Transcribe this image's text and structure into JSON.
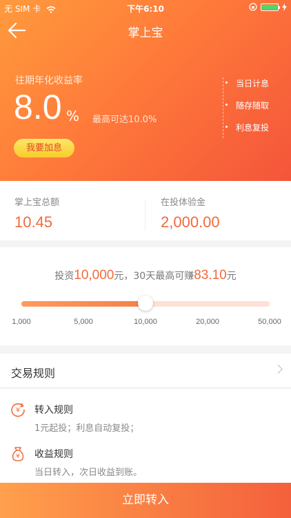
{
  "status_bar": {
    "carrier": "无 SIM 卡",
    "time": "下午6:10"
  },
  "nav": {
    "title": "掌上宝"
  },
  "hero": {
    "rate_label": "往期年化收益率",
    "rate_value": "8.0",
    "rate_unit": "%",
    "rate_max": "最高可达10.0%",
    "add_button": "我要加息",
    "features": [
      "当日计息",
      "随存随取",
      "利息复投"
    ]
  },
  "amounts": {
    "total_label": "掌上宝总额",
    "total_value": "10.45",
    "trial_label": "在投体验金",
    "trial_value": "2,000.00"
  },
  "calculator": {
    "prefix": "投资",
    "amount": "10,000",
    "middle": "元，30天最高可赚",
    "earnings": "83.10",
    "suffix": "元",
    "slider_value": 10000,
    "ticks": [
      "1,000",
      "5,000",
      "10,000",
      "20,000",
      "50,000"
    ]
  },
  "rules": {
    "title": "交易规则",
    "items": [
      {
        "title": "转入规则",
        "desc": "1元起投；利息自动复投；",
        "icon": "transfer-in-icon"
      },
      {
        "title": "收益规则",
        "desc": "当日转入，次日收益到账。",
        "icon": "money-bag-icon"
      }
    ]
  },
  "cta": {
    "label": "立即转入"
  },
  "colors": {
    "accent": "#f06a3c",
    "gradient_start": "#ff9a3c",
    "gradient_end": "#f4553a",
    "button_yellow": "#f7cd2a"
  }
}
